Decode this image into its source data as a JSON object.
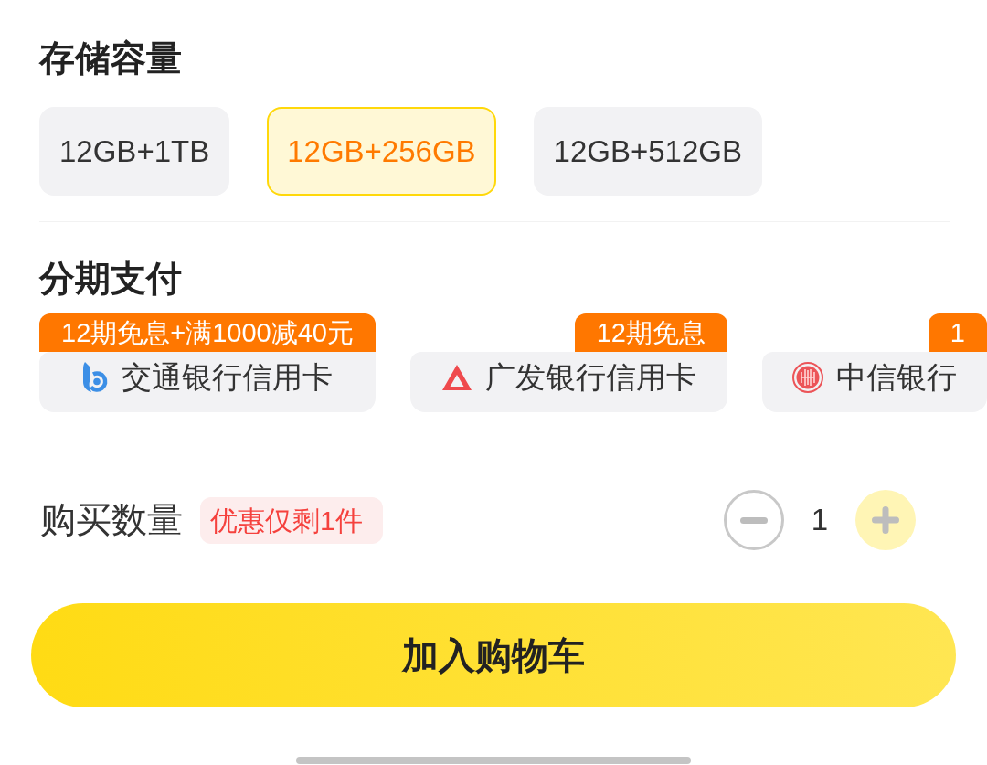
{
  "storage": {
    "title": "存储容量",
    "options": [
      {
        "label": "12GB+1TB",
        "selected": false
      },
      {
        "label": "12GB+256GB",
        "selected": true
      },
      {
        "label": "12GB+512GB",
        "selected": false
      }
    ]
  },
  "installment": {
    "title": "分期支付",
    "plans": [
      {
        "kind": "swirl",
        "badge": "12期免息+满1000减40元",
        "name": "交通银行信用卡",
        "selected": false
      },
      {
        "kind": "triangle",
        "badge": "12期免息",
        "name": "广发银行信用卡",
        "selected": false
      },
      {
        "kind": "ring",
        "badge": "1",
        "name": "中信银行",
        "selected": false
      }
    ]
  },
  "quantity": {
    "label": "购买数量",
    "badge": "优惠仅剩1件",
    "value": "1",
    "decrease_disabled": true
  },
  "cart_button": {
    "label": "加入购物车"
  }
}
